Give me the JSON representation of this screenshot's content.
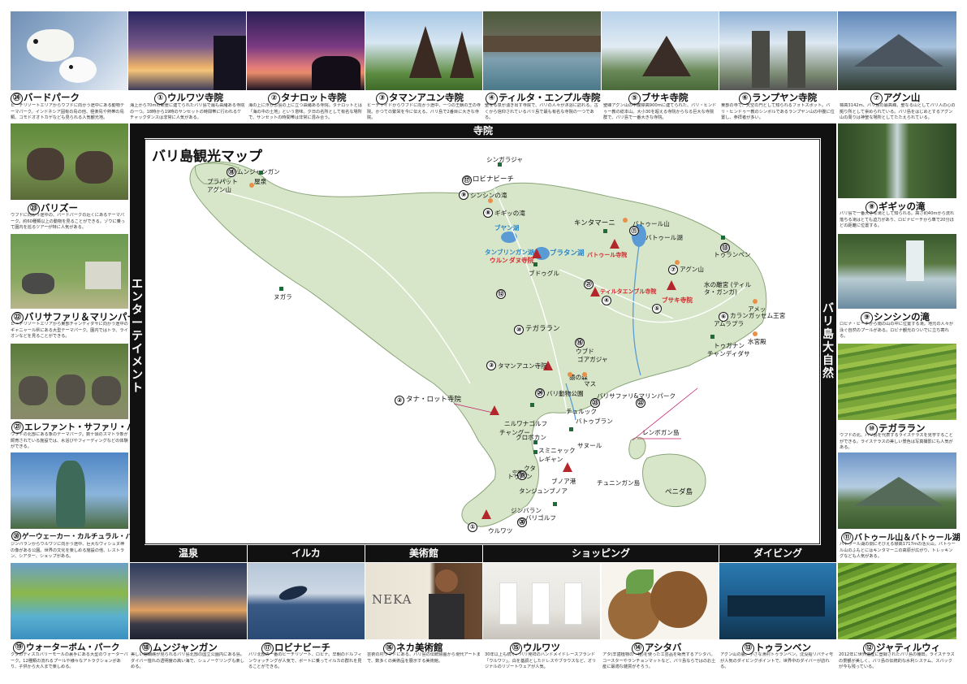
{
  "map": {
    "title": "バリ島観光マップ",
    "bands": {
      "top": "寺院",
      "left": "エンターテイメント",
      "right": "バリ島大自然",
      "bottom": [
        "温泉",
        "イルカ",
        "美術館",
        "ショッピング",
        "ダイビング"
      ]
    },
    "places": [
      {
        "n": "⑰",
        "text": "ロビナビーチ"
      },
      {
        "n": "⑱",
        "text": "ムンジャンガン"
      },
      {
        "n": "⑨",
        "text": "シンシンの滝"
      },
      {
        "n": "⑧",
        "text": "ギギッの滝"
      },
      {
        "n": "⑪",
        "text": "バトゥール湖"
      },
      {
        "n": "⑬",
        "text": "トゥランベン"
      },
      {
        "n": "⑦",
        "text": "アグン山"
      },
      {
        "n": "⑥",
        "text": "カランガッセム王宮"
      },
      {
        "n": "⑤",
        "text": "ブサキ寺院"
      },
      {
        "n": "④",
        "text": "ティルタエンブル寺院"
      },
      {
        "n": "㉑",
        "text": ""
      },
      {
        "n": "⑫",
        "text": ""
      },
      {
        "n": "⑩",
        "text": "テガララン"
      },
      {
        "n": "⑯",
        "text": "ウブド"
      },
      {
        "n": "③",
        "text": "タマンアユン寺院"
      },
      {
        "n": "㉔",
        "text": "バリ動物公園"
      },
      {
        "n": "②",
        "text": "タナ・ロット寺院"
      },
      {
        "n": "㉓",
        "text": "バリサファリ&マリンパーク"
      },
      {
        "n": "㉒",
        "text": ""
      },
      {
        "n": "⑳",
        "text": ""
      },
      {
        "n": "⑲",
        "text": ""
      },
      {
        "n": "①",
        "text": "ウルワツ"
      }
    ],
    "labels": {
      "singaraja": "シンガラジャ",
      "menjangan": "ムンジャンガン",
      "terrace": "屋泉",
      "prapat": "プラパット",
      "agung_w": "アグン山",
      "negara": "ヌガラ",
      "bratan": "ブラタン湖",
      "buyan": "ブヤン湖",
      "tamblingan": "タンブリンガン湖",
      "ulun": "ウルン",
      "danu": "ダヌ寺院",
      "bedugul": "ブドゥグル",
      "kintamani": "キンタマーニ",
      "batur_mt": "バトゥール山",
      "batur_temple": "バトゥール寺院",
      "tulamben": "トゥランベン",
      "agung": "アグン山",
      "tirta_gangga": "水の離宮 (ティルタ・ガンガ)",
      "amed": "アメッ",
      "amlapura": "アムラプラ",
      "candidasa": "チャンディダサ",
      "tenganan": "トゥガナン",
      "padangbai": "水宮殿",
      "goa": "ゴアガジャ",
      "monkey": "猿の森",
      "mas": "マス",
      "celuk": "チュルック",
      "batubulan": "バトゥブラン",
      "nirwana": "ニルワナゴルフ",
      "canggu": "チャングー",
      "kerobokan": "クロボカン",
      "seminyak": "スミニャック",
      "legian": "レギャン",
      "kuta": "クタ",
      "sanur": "サヌール",
      "tuban": "トゥバン",
      "tanjung": "タンジュンブノア",
      "benoa": "ブノア港",
      "jimbaran": "ジンバラン",
      "garden": "バリゴルフ",
      "uluwatu": "ウルワツ",
      "lembongan": "レンボガン島",
      "ceningan": "チュニンガン島",
      "penida": "ペニダ島",
      "ubud": "ウブド",
      "tampaksiring": "ティルタエンブル寺院",
      "besakih": "ブサキ寺院",
      "airport": "空港"
    }
  },
  "top_row": [
    {
      "n": "㉔",
      "title": "バードパーク",
      "desc": "ビーチリゾートエリアからウブドに向かう途中にある動物テーマパーク。インドネシア固有の鳥の他、極楽鳥や熱帯の鳥類、コモドオオトカゲなども見られる人気観光地。"
    },
    {
      "n": "①",
      "title": "ウルワツ寺院",
      "desc": "海上から70mの断崖に建てられたバリ島で最も由緒ある寺院の一つ。18時から19時のサンセットの時間帯に行われるケチャックダンスは非常に人気がある。"
    },
    {
      "n": "②",
      "title": "タナロット寺院",
      "desc": "海の上に浮かぶ島の上に立つ由緒ある寺院。タナロットとは「海の中の土地」という意味。夕日の名所として有名な場所で、サンセットの時間帯は非常に混み合う。"
    },
    {
      "n": "③",
      "title": "タマンアユン寺院",
      "desc": "ビーチサイドからウブドに向かう途中、一つの王朝の王の寺院。かつての繁栄を今に伝える、バリ島で2番目に大きな寺院。"
    },
    {
      "n": "④",
      "title": "ティルタ・エンプル寺院",
      "desc": "聖なる泉が湧き出す寺院で、バリの人々が沐浴に訪れる。古くから信仰されているバリ島で最も有名な寺院の一つである。"
    },
    {
      "n": "⑤",
      "title": "ブサキ寺院",
      "desc": "聖峰アグン山の中腹標高900mに建てられた、バリ・ヒンドゥー教の総本山。大小30を超える寺院からなる巨大な寺院群で、バリ島で一番大きな寺院。"
    },
    {
      "n": "⑥",
      "title": "ランプヤン寺院",
      "desc": "東部の寺で、天空の門として知られるフォトスポット。バリ・ヒンドゥー教のシンボルであるランプヤン山の中腹に位置し、参拝者が多い。"
    },
    {
      "n": "⑦",
      "title": "アグン山",
      "desc": "標高3142m、バリ島の最高峰。聖なる山としてバリ人の心の拠り所として崇められている。バリ島をはじめとするアグン山の周りは神聖な場所としてたたえられている。"
    }
  ],
  "left_col": [
    {
      "n": "㉓",
      "title": "バリズー",
      "desc": "ウブドに向かう途中の、バードパークの近くにあるテーマパーク。約60種類以上の動物を見ることができる。ゾウに乗って園内を巡るツアーが特に人気がある。"
    },
    {
      "n": "㉒",
      "title": "バリサファリ＆マリンパーク",
      "desc": "ビーチリゾートエリアから東部チャンディダサに向かう途中のギャニャール県にある大型テーマパーク。園内ではトラ、ライオンなどを見ることができる。"
    },
    {
      "n": "㉑",
      "title": "エレファント・サファリ・パーク",
      "desc": "ウブドの北部にある象のテーマパーク。数十頭のスマトラ象が飼育されている施設では、水浴びやフィーディングなどの体験ができる。"
    },
    {
      "n": "⑳",
      "title": "ゲーウェーカー・カルチュラル・パーク",
      "desc": "ジンバランからウルワツに向かう途中、巨大なヴィシュヌ神の像がある公園。世界の文化を楽しめる施設の他、レストラン、シアター、ショップがある。"
    }
  ],
  "right_col": [
    {
      "n": "⑧",
      "title": "ギギッの滝",
      "desc": "バリ島で一番大きな滝として知られる。高さ約40mから流れ落ちる滝はとても迫力があり、ロビナビーチから車で20分ほどの距離に位置する。"
    },
    {
      "n": "⑨",
      "title": "シンシンの滝",
      "desc": "ロビナ・ビーチから南の山の中に位置する滝。地元の人々が泳ぐ自然のプールがある。ロビナ観光のついでに立ち寄れる。"
    },
    {
      "n": "⑩",
      "title": "テガララン",
      "desc": "ウブドの北、バリ島を代表するライステラスを見学することができる。ライステラスの美しい景色は写真撮影にも人気がある。"
    },
    {
      "n": "⑪",
      "title": "バトゥール山＆バトゥール湖",
      "desc": "バトゥール湖の側にそびえる標高1717mの活火山。バトゥール山のふもとにはキンタマーニの高原が広がり、トレッキングなども人気がある。"
    }
  ],
  "bottom_row": [
    {
      "n": "⑲",
      "title": "ウォーターボム・パーク",
      "desc": "クタのディスカバリーモールの裏手にある大型のウォーターパーク。12種類の流れるプールや様々なアトラクションがあり、子供から大人まで楽しめる。"
    },
    {
      "n": "⑱",
      "title": "ムンジャンガン",
      "desc": "美しい珊瑚礁が見られるバリ島北部の国立公園内にある島。ダイバー憧れの透明度の高い海で、シュノーケリングも楽しめる。"
    },
    {
      "n": "⑰",
      "title": "ロビナビーチ",
      "desc": "バリ北部の一番のビーチリゾート、ロビナ。早朝のドルフィンウォッチングが人気で、ボートに乗ってイルカの群れを見ることができる。"
    },
    {
      "n": "⑯",
      "title": "ネカ美術館",
      "desc": "芸術の村ウブドにある、バリ島の伝統絵画から現代アートまで、数多くの美術品を展示する美術館。"
    },
    {
      "n": "⑮",
      "title": "ウルワツ",
      "desc": "30年以上も続く、バリ発祥のハンドメイドレースブランド「ウルワツ」。白を基調としたドレスやブラウスなど、オリジナルのリゾートウェアが人気。"
    },
    {
      "n": "⑭",
      "title": "アシタバ",
      "desc": "アタ(羊歯植物の一種)を使った工芸品を販売するアシタバ。コースターやランチョンマットなど、バリ島ならではのお土産に最適な雑貨がそろう。"
    },
    {
      "n": "⑬",
      "title": "トゥランベン",
      "desc": "アグン山の麓、小さな漁村トゥランベン。沈没船リバティ号が人気のダイビングポイントで、世界中のダイバーが訪れる。"
    },
    {
      "n": "⑫",
      "title": "ジャティルウィ",
      "desc": "2012年に世界遺産に登録されたバリ島の棚田。ライステラスの景観が美しく、バリ島の伝統的な水利システム、スバックが今も残っている。"
    }
  ]
}
